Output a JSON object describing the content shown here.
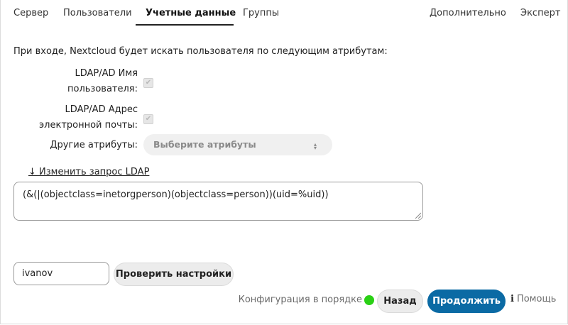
{
  "tabs": {
    "server": "Сервер",
    "users": "Пользователи",
    "login": "Учетные данные",
    "groups": "Группы",
    "advanced": "Дополнительно",
    "expert": "Эксперт",
    "active": "login"
  },
  "main": {
    "intro": "При входе, Nextcloud будет искать пользователя по следующим атрибутам:",
    "attr_username_label_1": "LDAP/AD Имя",
    "attr_username_label_2": "пользователя:",
    "attr_username_checked": true,
    "attr_email_label_1": "LDAP/AD Адрес",
    "attr_email_label_2": "электронной почты:",
    "attr_email_checked": true,
    "other_attrs_label": "Другие атрибуты:",
    "other_attrs_placeholder": "Выберите атрибуты",
    "edit_query_link": "↓ Изменить запрос LDAP",
    "query_value": "(&(|(objectclass=inetorgperson)(objectclass=person))(uid=%uid))",
    "test_user_value": "ivanov",
    "verify_button": "Проверить настройки"
  },
  "footer": {
    "status_text": "Конфигурация в порядке",
    "status_color": "#2ad015",
    "back_button": "Назад",
    "continue_button": "Продолжить",
    "help_icon": "info-icon",
    "help_label": "Помощь"
  },
  "colors": {
    "primary": "#0b6aa4"
  }
}
